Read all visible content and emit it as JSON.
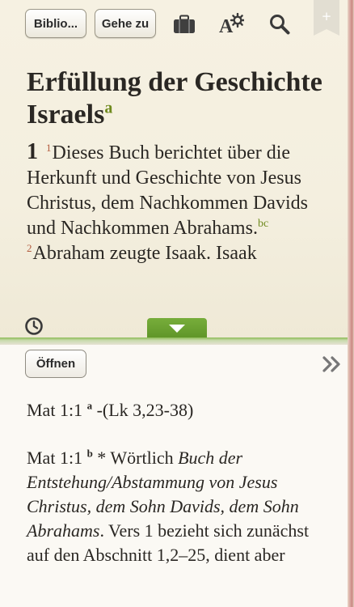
{
  "toolbar": {
    "library_label": "Biblio...",
    "goto_label": "Gehe zu",
    "icons": [
      "briefcase-icon",
      "text-settings-icon",
      "search-icon",
      "bookmark-ribbon-icon"
    ],
    "ribbon_symbol": "+"
  },
  "reader": {
    "title": "Erfüllung der Geschichte Israels",
    "title_footnote": "a",
    "chapter": "1",
    "verse1_number": "1",
    "verse1_text": "Dieses Buch berichtet über die Herkunft und Geschichte von Jesus Christus, dem Nachkommen Davids und Nachkommen Abrahams.",
    "verse1_footnotes": "bc",
    "verse2_number": "2",
    "verse2_text": "Abraham zeugte Isaak. Isaak"
  },
  "notes": {
    "open_label": "Öffnen",
    "note_a": {
      "ref": "Mat 1:1",
      "mark": "a",
      "text": "-(Lk 3,23-38)"
    },
    "note_b": {
      "ref": "Mat 1:1",
      "mark": "b",
      "lead": "* Wörtlich",
      "italic": "Buch der Entstehung/Abstammung von Jesus Christus, dem Sohn Davids, dem Sohn Abrahams",
      "rest": ". Vers 1 bezieht sich zunächst auf den Abschnitt 1,2–25, dient aber"
    }
  },
  "colors": {
    "footnote_green": "#6f8a1e",
    "verse_number": "#b25a3d",
    "handle_green": "#6aa033",
    "paper": "#f4efdf"
  }
}
